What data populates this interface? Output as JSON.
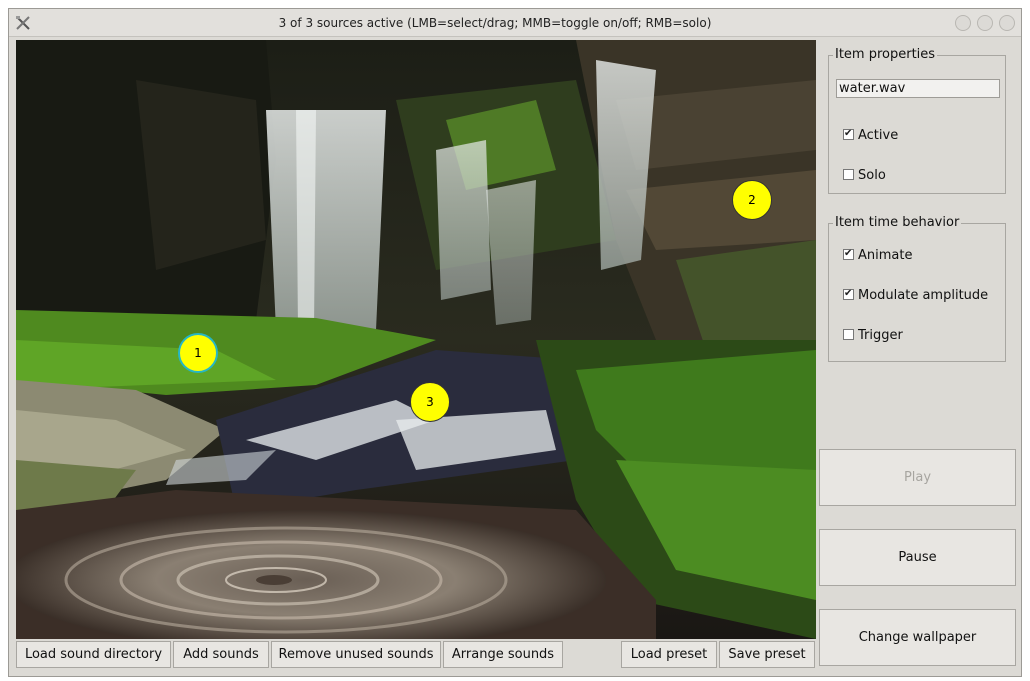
{
  "window": {
    "title": "3 of 3 sources active (LMB=select/drag; MMB=toggle on/off; RMB=solo)"
  },
  "sources": [
    {
      "label": "1",
      "selected": true
    },
    {
      "label": "2",
      "selected": false
    },
    {
      "label": "3",
      "selected": false
    }
  ],
  "bottom_bar": {
    "load_sound_directory": "Load sound directory",
    "add_sounds": "Add sounds",
    "remove_unused_sounds": "Remove unused sounds",
    "arrange_sounds": "Arrange sounds",
    "load_preset": "Load preset",
    "save_preset": "Save preset"
  },
  "item_properties": {
    "title": "Item properties",
    "name": "water.wav",
    "active_label": "Active",
    "active_checked": true,
    "solo_label": "Solo",
    "solo_checked": false
  },
  "item_time_behavior": {
    "title": "Item time behavior",
    "animate_label": "Animate",
    "animate_checked": true,
    "modulate_label": "Modulate amplitude",
    "modulate_checked": true,
    "trigger_label": "Trigger",
    "trigger_checked": false
  },
  "controls": {
    "play": "Play",
    "play_enabled": false,
    "pause": "Pause",
    "change_wallpaper": "Change wallpaper"
  },
  "colors": {
    "source_fill": "#ffff00",
    "selected_ring": "#26b7c5"
  }
}
